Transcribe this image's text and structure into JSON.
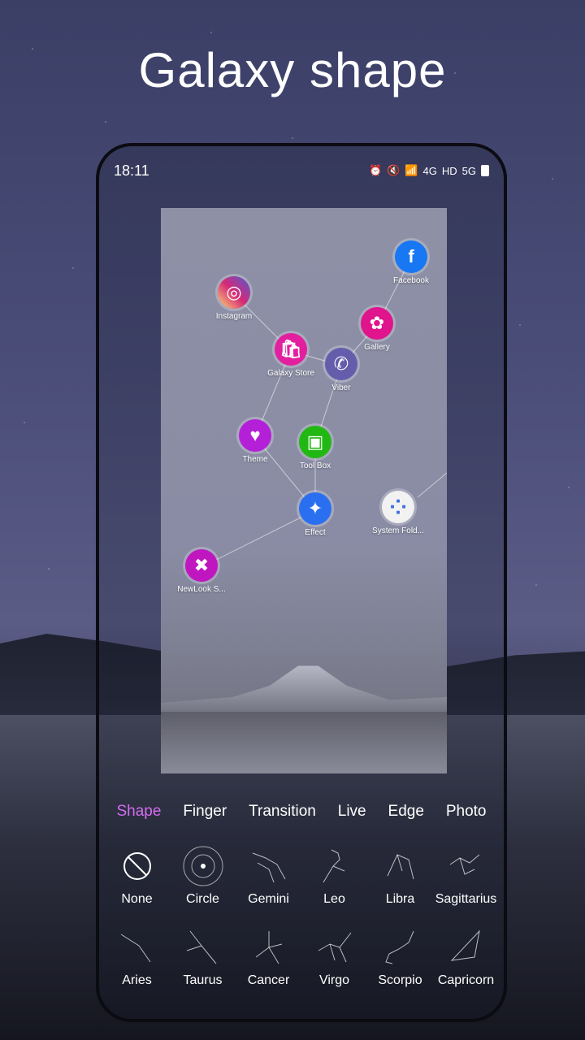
{
  "headline": "Galaxy shape",
  "status_bar": {
    "time": "18:11",
    "icons": [
      "alarm-icon",
      "mute-icon",
      "wifi-icon",
      "4g-icon",
      "hd-icon",
      "5g-signal-icon",
      "battery-icon"
    ],
    "net_label": "4G",
    "hd_label": "HD",
    "fiveg_label": "5G"
  },
  "apps": [
    {
      "name": "Facebook",
      "icon": "facebook-icon",
      "glyph": "f",
      "color": "#1877f2"
    },
    {
      "name": "Instagram",
      "icon": "instagram-icon",
      "glyph": "◎",
      "color": "#d62976"
    },
    {
      "name": "Gallery",
      "icon": "gallery-icon",
      "glyph": "✿",
      "color": "#e0148c"
    },
    {
      "name": "Galaxy Store",
      "icon": "galaxy-store-icon",
      "glyph": "🛍",
      "color": "#e21f9f"
    },
    {
      "name": "Viber",
      "icon": "viber-icon",
      "glyph": "✆",
      "color": "#665cac"
    },
    {
      "name": "Theme",
      "icon": "theme-icon",
      "glyph": "♥",
      "color": "#b41fd8"
    },
    {
      "name": "Tool Box",
      "icon": "toolbox-icon",
      "glyph": "▣",
      "color": "#22b814"
    },
    {
      "name": "Effect",
      "icon": "effect-icon",
      "glyph": "✦",
      "color": "#2a6ff0"
    },
    {
      "name": "System Fold...",
      "icon": "system-folder-icon",
      "glyph": "⁘",
      "color": "#f2f2f2"
    },
    {
      "name": "NewLook S...",
      "icon": "newlook-icon",
      "glyph": "✖",
      "color": "#c016c0"
    }
  ],
  "tabs": [
    {
      "label": "Shape",
      "active": true
    },
    {
      "label": "Finger",
      "active": false
    },
    {
      "label": "Transition",
      "active": false
    },
    {
      "label": "Live",
      "active": false
    },
    {
      "label": "Edge",
      "active": false
    },
    {
      "label": "Photo",
      "active": false
    }
  ],
  "shapes": [
    {
      "name": "None",
      "icon": "none-icon"
    },
    {
      "name": "Circle",
      "icon": "circle-icon"
    },
    {
      "name": "Gemini",
      "icon": "gemini-icon"
    },
    {
      "name": "Leo",
      "icon": "leo-icon"
    },
    {
      "name": "Libra",
      "icon": "libra-icon"
    },
    {
      "name": "Sagittarius",
      "icon": "sagittarius-icon"
    },
    {
      "name": "Aries",
      "icon": "aries-icon"
    },
    {
      "name": "Taurus",
      "icon": "taurus-icon"
    },
    {
      "name": "Cancer",
      "icon": "cancer-icon"
    },
    {
      "name": "Virgo",
      "icon": "virgo-icon"
    },
    {
      "name": "Scorpio",
      "icon": "scorpio-icon"
    },
    {
      "name": "Capricorn",
      "icon": "capricorn-icon"
    }
  ],
  "colors": {
    "active_tab": "#d36cf0",
    "text": "#ffffff"
  }
}
